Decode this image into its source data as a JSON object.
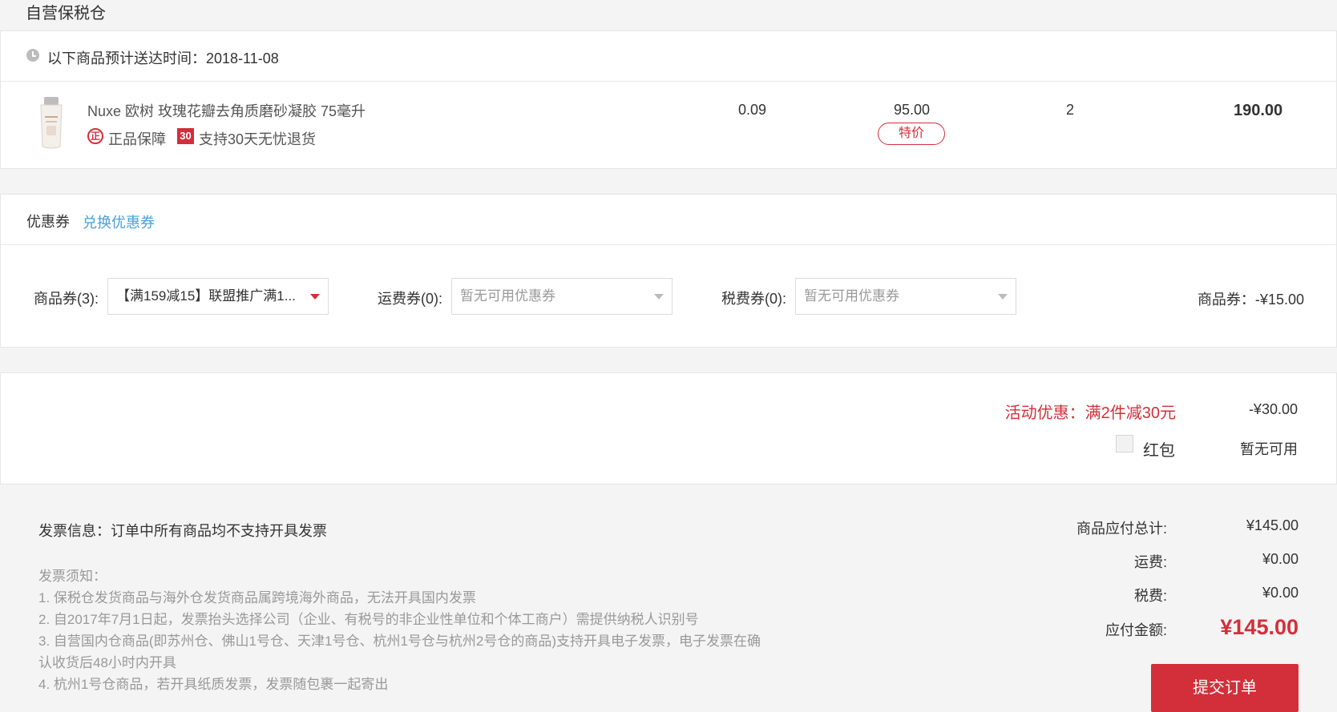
{
  "section": {
    "title": "自营保税仓"
  },
  "delivery": {
    "label": "以下商品预计送达时间：2018-11-08"
  },
  "product": {
    "name": "Nuxe 欧树 玫瑰花瓣去角质磨砂凝胶 75毫升",
    "tag_genuine": "正品保障",
    "tag_genuine_icon": "正",
    "tag_return": "支持30天无忧退货",
    "tag_return_icon": "30",
    "tax": "0.09",
    "price": "95.00",
    "price_tag": "特价",
    "quantity": "2",
    "subtotal": "190.00"
  },
  "coupon": {
    "header_label": "优惠券",
    "exchange_link": "兑换优惠券",
    "goods_label": "商品券(3):",
    "goods_selected": "【满159减15】联盟推广满1...",
    "shipping_label": "运费券(0):",
    "shipping_placeholder": "暂无可用优惠券",
    "tax_label": "税费券(0):",
    "tax_placeholder": "暂无可用优惠券",
    "summary": "商品券：-¥15.00"
  },
  "promo": {
    "label": "活动优惠：满2件减30元",
    "value": "-¥30.00",
    "redpacket_label": "红包",
    "redpacket_status": "暂无可用"
  },
  "invoice": {
    "info": "发票信息：订单中所有商品均不支持开具发票",
    "notice_title": "发票须知：",
    "notes": [
      "1. 保税仓发货商品与海外仓发货商品属跨境海外商品，无法开具国内发票",
      "2. 自2017年7月1日起，发票抬头选择公司（企业、有税号的非企业性单位和个体工商户）需提供纳税人识别号",
      "3. 自营国内仓商品(即苏州仓、佛山1号仓、天津1号仓、杭州1号仓与杭州2号仓的商品)支持开具电子发票，电子发票在确",
      "认收货后48小时内开具",
      "4. 杭州1号仓商品，若开具纸质发票，发票随包裹一起寄出"
    ]
  },
  "totals": {
    "goods_total_label": "商品应付总计:",
    "goods_total_value": "¥145.00",
    "shipping_label": "运费:",
    "shipping_value": "¥0.00",
    "tax_label": "税费:",
    "tax_value": "¥0.00",
    "payable_label": "应付金额:",
    "payable_value": "¥145.00",
    "submit_label": "提交订单"
  },
  "colors": {
    "accent": "#d32f3a",
    "link": "#4a9fd8"
  }
}
